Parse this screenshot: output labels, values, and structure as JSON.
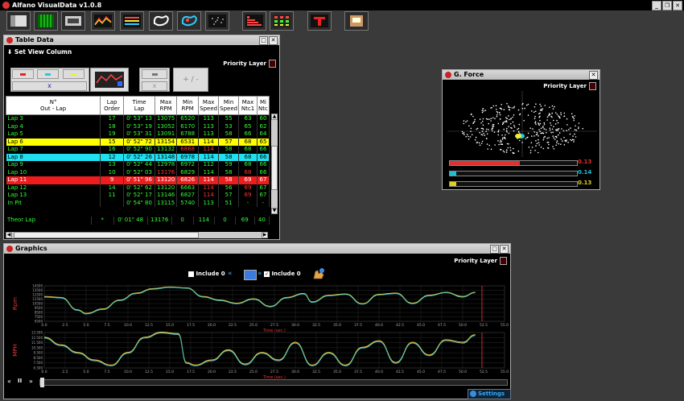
{
  "app": {
    "title": "Alfano VisualData v1.0.8"
  },
  "toolbar": {
    "icons": [
      "table-view-icon",
      "spreadsheet-icon",
      "laps-icon",
      "graphics-icon",
      "compare-icon",
      "track-map-icon",
      "track-overlay-icon",
      "gforce-icon",
      "histogram-icon",
      "matrix-icon",
      "teleport-icon",
      "export-icon"
    ]
  },
  "table_window": {
    "title": "Table Data",
    "set_view": "Set View Column",
    "priority": "Priority Layer",
    "btn_x": "x",
    "btn_plusminus": "+ / -",
    "headers": [
      "N°\nOut - Lap",
      "Lap\nOrder",
      "Time\nLap",
      "Max\nRPM",
      "Min\nRPM",
      "Max\nSpeed",
      "Min\nSpeed",
      "Max\nNtc1",
      "Mi\nNtc"
    ],
    "rows": [
      [
        "Lap 3",
        "17",
        "0' 53\" 13",
        "13075",
        "6520",
        "113",
        "55",
        "63",
        "60"
      ],
      [
        "Lap 4",
        "18",
        "0' 53\" 19",
        "13052",
        "6170",
        "113",
        "53",
        "65",
        "62"
      ],
      [
        "Lap 5",
        "19",
        "0' 53\" 31",
        "13091",
        "6788",
        "113",
        "58",
        "66",
        "64"
      ],
      [
        "Lap 6",
        "15",
        "0' 52\" 72",
        "13154",
        "6531",
        "114",
        "57",
        "68",
        "65"
      ],
      [
        "Lap 7",
        "16",
        "0' 52\" 90",
        "13132",
        "6868",
        "114",
        "58",
        "68",
        "66"
      ],
      [
        "Lap 8",
        "12",
        "0' 52\" 26",
        "13148",
        "6978",
        "114",
        "58",
        "68",
        "66"
      ],
      [
        "Lap 9",
        "13",
        "0' 52\" 44",
        "12978",
        "6972",
        "112",
        "59",
        "68",
        "66"
      ],
      [
        "Lap 10",
        "10",
        "0' 52\" 03",
        "13176",
        "6829",
        "114",
        "58",
        "68",
        "66"
      ],
      [
        "Lap 11",
        "9",
        "0' 51\" 96",
        "13120",
        "6826",
        "114",
        "58",
        "69",
        "67"
      ],
      [
        "Lap 12",
        "14",
        "0' 52\" 62",
        "13120",
        "6663",
        "114",
        "56",
        "69",
        "67"
      ],
      [
        "Lap 13",
        "11",
        "0' 52\" 17",
        "13146",
        "6827",
        "114",
        "57",
        "69",
        "67"
      ],
      [
        "In Pit",
        "",
        "0' 54\" 80",
        "13115",
        "5740",
        "113",
        "51",
        "-",
        "-"
      ]
    ],
    "theor": [
      "Theor Lap",
      "*",
      "0' 01\" 48",
      "13176",
      "0",
      "114",
      "0",
      "69",
      "40"
    ]
  },
  "gforce_window": {
    "title": "G. Force",
    "priority": "Priority Layer",
    "bars": [
      {
        "value": "0.13",
        "color": "#e03030",
        "level": 0.55
      },
      {
        "value": "0.14",
        "color": "#20c0d0",
        "level": 0.05
      },
      {
        "value": "0.13",
        "color": "#e0d020",
        "level": 0.05
      }
    ]
  },
  "graphics_window": {
    "title": "Graphics",
    "priority": "Priority Layer",
    "include0_left": "Include 0",
    "include0_right": "Include 0",
    "nav_prev": "«",
    "nav_next": "»",
    "chart1_ylabel": "Rpm",
    "chart2_ylabel": "MPH",
    "chart_xlabel": "Time (sec.)",
    "x_ticks": [
      "0.0",
      "2.5",
      "5.0",
      "7.5",
      "10.0",
      "12.5",
      "15.0",
      "17.5",
      "20.0",
      "22.5",
      "25.0",
      "27.5",
      "30.0",
      "32.5",
      "35.0",
      "37.5",
      "40.0",
      "42.5",
      "45.0",
      "47.5",
      "50.0",
      "52.5",
      "55.0"
    ],
    "chart1_yticks": [
      "14500",
      "13500",
      "12500",
      "11500",
      "10500",
      "9500",
      "8500",
      "7500",
      "6500"
    ],
    "chart2_yticks": [
      "13.500",
      "12.500",
      "11.500",
      "10.500",
      "9.500",
      "8.500",
      "7.500",
      "6.500"
    ],
    "settings": "Settings",
    "play_rew": "«",
    "play_pause": "II",
    "play_ff": "»"
  },
  "chart_data": [
    {
      "type": "line",
      "title": "",
      "ylabel": "Rpm",
      "xlabel": "Time (sec.)",
      "xlim": [
        0,
        55
      ],
      "series": [
        {
          "color": "#ff5050",
          "x": [
            0,
            2,
            4,
            5,
            7,
            9,
            11,
            13,
            15,
            17,
            19,
            21,
            23,
            25,
            27,
            29,
            31,
            32,
            34,
            36,
            38,
            40,
            42,
            44,
            46,
            48,
            50,
            51.5
          ],
          "values": [
            12000,
            11800,
            9000,
            8200,
            9200,
            11200,
            12800,
            13800,
            14200,
            14000,
            12000,
            11200,
            10500,
            11500,
            9800,
            11800,
            12700,
            10800,
            12300,
            12600,
            10400,
            12500,
            12800,
            10500,
            12300,
            13000,
            12000,
            13000
          ]
        },
        {
          "color": "#e0d030",
          "x": [
            0,
            2,
            4,
            5,
            7,
            9,
            11,
            13,
            15,
            17,
            19,
            21,
            23,
            25,
            27,
            29,
            31,
            32,
            34,
            36,
            38,
            40,
            42,
            44,
            46,
            48,
            50,
            51.5
          ],
          "values": [
            12100,
            11900,
            9100,
            8300,
            9300,
            11300,
            12900,
            13900,
            14250,
            14050,
            12100,
            11300,
            10600,
            11600,
            9900,
            11900,
            12800,
            10900,
            12400,
            12700,
            10500,
            12600,
            12900,
            10600,
            12400,
            13050,
            12100,
            13050
          ]
        },
        {
          "color": "#30c0d0",
          "x": [
            0,
            2,
            4,
            5,
            7,
            9,
            11,
            13,
            15,
            17,
            19,
            21,
            23,
            25,
            27,
            29,
            31,
            32,
            34,
            36,
            38,
            40,
            42,
            44,
            46,
            48,
            50,
            51.5
          ],
          "values": [
            11950,
            11750,
            8950,
            8150,
            9150,
            11150,
            12750,
            13750,
            14150,
            13950,
            11950,
            11150,
            10450,
            11450,
            9750,
            11750,
            12650,
            10750,
            12250,
            12550,
            10350,
            12450,
            12750,
            10450,
            12250,
            12950,
            11950,
            12950
          ]
        }
      ]
    },
    {
      "type": "line",
      "title": "",
      "ylabel": "MPH",
      "xlabel": "Time (sec.)",
      "xlim": [
        0,
        55
      ],
      "series": [
        {
          "color": "#ff5050",
          "x": [
            0,
            2,
            4,
            6,
            8,
            10,
            12,
            14,
            16,
            17,
            18,
            20,
            22,
            24,
            26,
            28,
            30,
            32,
            34,
            36,
            38,
            40,
            42,
            44,
            46,
            48,
            50,
            51.5
          ],
          "values": [
            12.5,
            11.0,
            9.5,
            8.0,
            7.0,
            9.5,
            12.5,
            13.5,
            13.2,
            7.5,
            7.0,
            8.0,
            10.0,
            7.2,
            9.5,
            8.0,
            11.5,
            7.0,
            9.5,
            7.0,
            10.5,
            11.8,
            7.5,
            11.5,
            9.0,
            12.0,
            11.5,
            13.0
          ]
        },
        {
          "color": "#e0d030",
          "x": [
            0,
            2,
            4,
            6,
            8,
            10,
            12,
            14,
            16,
            17,
            18,
            20,
            22,
            24,
            26,
            28,
            30,
            32,
            34,
            36,
            38,
            40,
            42,
            44,
            46,
            48,
            50,
            51.5
          ],
          "values": [
            12.6,
            11.1,
            9.6,
            8.1,
            7.1,
            9.6,
            12.6,
            13.6,
            13.3,
            7.6,
            7.1,
            8.1,
            10.1,
            7.3,
            9.6,
            8.1,
            11.6,
            7.1,
            9.6,
            7.1,
            10.6,
            11.9,
            7.6,
            11.6,
            9.1,
            12.1,
            11.6,
            13.1
          ]
        },
        {
          "color": "#30c0d0",
          "x": [
            0,
            2,
            4,
            6,
            8,
            10,
            12,
            14,
            16,
            17,
            18,
            20,
            22,
            24,
            26,
            28,
            30,
            32,
            34,
            36,
            38,
            40,
            42,
            44,
            46,
            48,
            50,
            51.5
          ],
          "values": [
            12.4,
            10.9,
            9.4,
            7.9,
            6.9,
            9.4,
            12.4,
            13.4,
            13.1,
            7.4,
            6.9,
            7.9,
            9.9,
            7.1,
            9.4,
            7.9,
            11.4,
            6.9,
            9.4,
            6.9,
            10.4,
            11.7,
            7.4,
            11.4,
            8.9,
            11.9,
            11.4,
            12.9
          ]
        }
      ]
    }
  ]
}
